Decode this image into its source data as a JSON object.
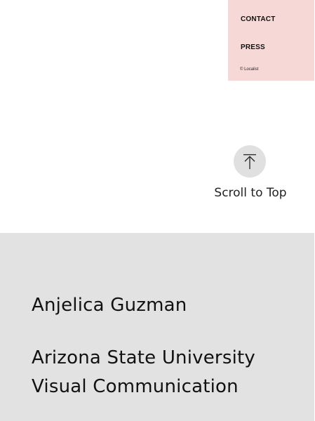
{
  "menu": {
    "contact_label": "CONTACT",
    "press_label": "PRESS",
    "copyright": "© Localist"
  },
  "scroll_to_top": {
    "label": "Scroll to Top",
    "icon": "arrow-up-to-line-icon"
  },
  "footer": {
    "name": "Anjelica Guzman",
    "school": "Arizona State University",
    "program": "Visual Communication"
  },
  "colors": {
    "menu_background": "#f6d8d7",
    "footer_background": "#e2e2e2",
    "scroll_circle": "#e0e0e0",
    "text": "#111111"
  }
}
